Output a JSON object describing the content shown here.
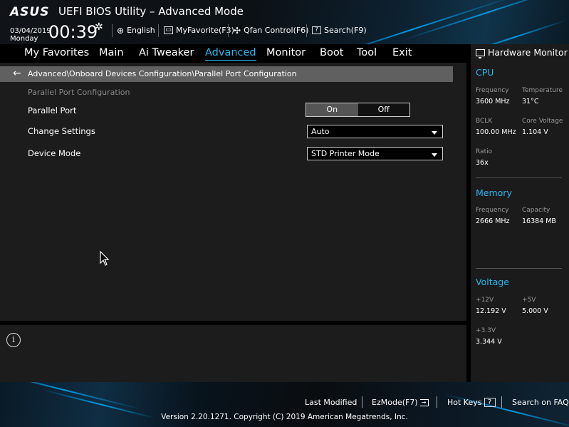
{
  "header": {
    "logo": "ASUS",
    "title": "UEFI BIOS Utility – Advanced Mode",
    "date": "03/04/2019",
    "day": "Monday",
    "time": "00:39",
    "toolbar": {
      "language": "English",
      "myfavorite": "MyFavorite(F3)",
      "qfan": "Qfan Control(F6)",
      "search": "Search(F9)"
    }
  },
  "nav": {
    "tabs": [
      {
        "label": "My Favorites"
      },
      {
        "label": "Main"
      },
      {
        "label": "Ai Tweaker"
      },
      {
        "label": "Advanced"
      },
      {
        "label": "Monitor"
      },
      {
        "label": "Boot"
      },
      {
        "label": "Tool"
      },
      {
        "label": "Exit"
      }
    ],
    "active": "Advanced"
  },
  "main": {
    "breadcrumb": "Advanced\\Onboard Devices Configuration\\Parallel Port Configuration",
    "section": "Parallel Port Configuration",
    "settings": {
      "parallel_port": {
        "label": "Parallel Port",
        "on": "On",
        "off": "Off",
        "selected": "On"
      },
      "change_settings": {
        "label": "Change Settings",
        "value": "Auto"
      },
      "device_mode": {
        "label": "Device Mode",
        "value": "STD Printer Mode"
      }
    }
  },
  "hwmon": {
    "title": "Hardware Monitor",
    "cpu": {
      "heading": "CPU",
      "frequency_label": "Frequency",
      "frequency": "3600 MHz",
      "temperature_label": "Temperature",
      "temperature": "31°C",
      "bclk_label": "BCLK",
      "bclk": "100.00 MHz",
      "core_voltage_label": "Core Voltage",
      "core_voltage": "1.104 V",
      "ratio_label": "Ratio",
      "ratio": "36x"
    },
    "memory": {
      "heading": "Memory",
      "frequency_label": "Frequency",
      "frequency": "2666 MHz",
      "capacity_label": "Capacity",
      "capacity": "16384 MB"
    },
    "voltage": {
      "heading": "Voltage",
      "v12_label": "+12V",
      "v12": "12.192 V",
      "v5_label": "+5V",
      "v5": "5.000 V",
      "v33_label": "+3.3V",
      "v33": "3.344 V"
    }
  },
  "footer": {
    "last_modified": "Last Modified",
    "ezmode": "EzMode(F7)",
    "hot_keys": "Hot Keys",
    "hot_keys_key": "?",
    "search_faq": "Search on FAQ",
    "version": "Version 2.20.1271. Copyright (C) 2019 American Megatrends, Inc."
  },
  "colors": {
    "accent": "#2bb8f0",
    "panel": "#1c1c1c",
    "breadcrumb_bar": "#606060"
  },
  "icons": [
    "globe-icon",
    "favorite-icon",
    "fan-icon",
    "search-icon",
    "gear-icon",
    "back-arrow-icon",
    "info-icon",
    "monitor-icon",
    "exit-icon",
    "help-icon",
    "mouse-cursor-icon"
  ]
}
